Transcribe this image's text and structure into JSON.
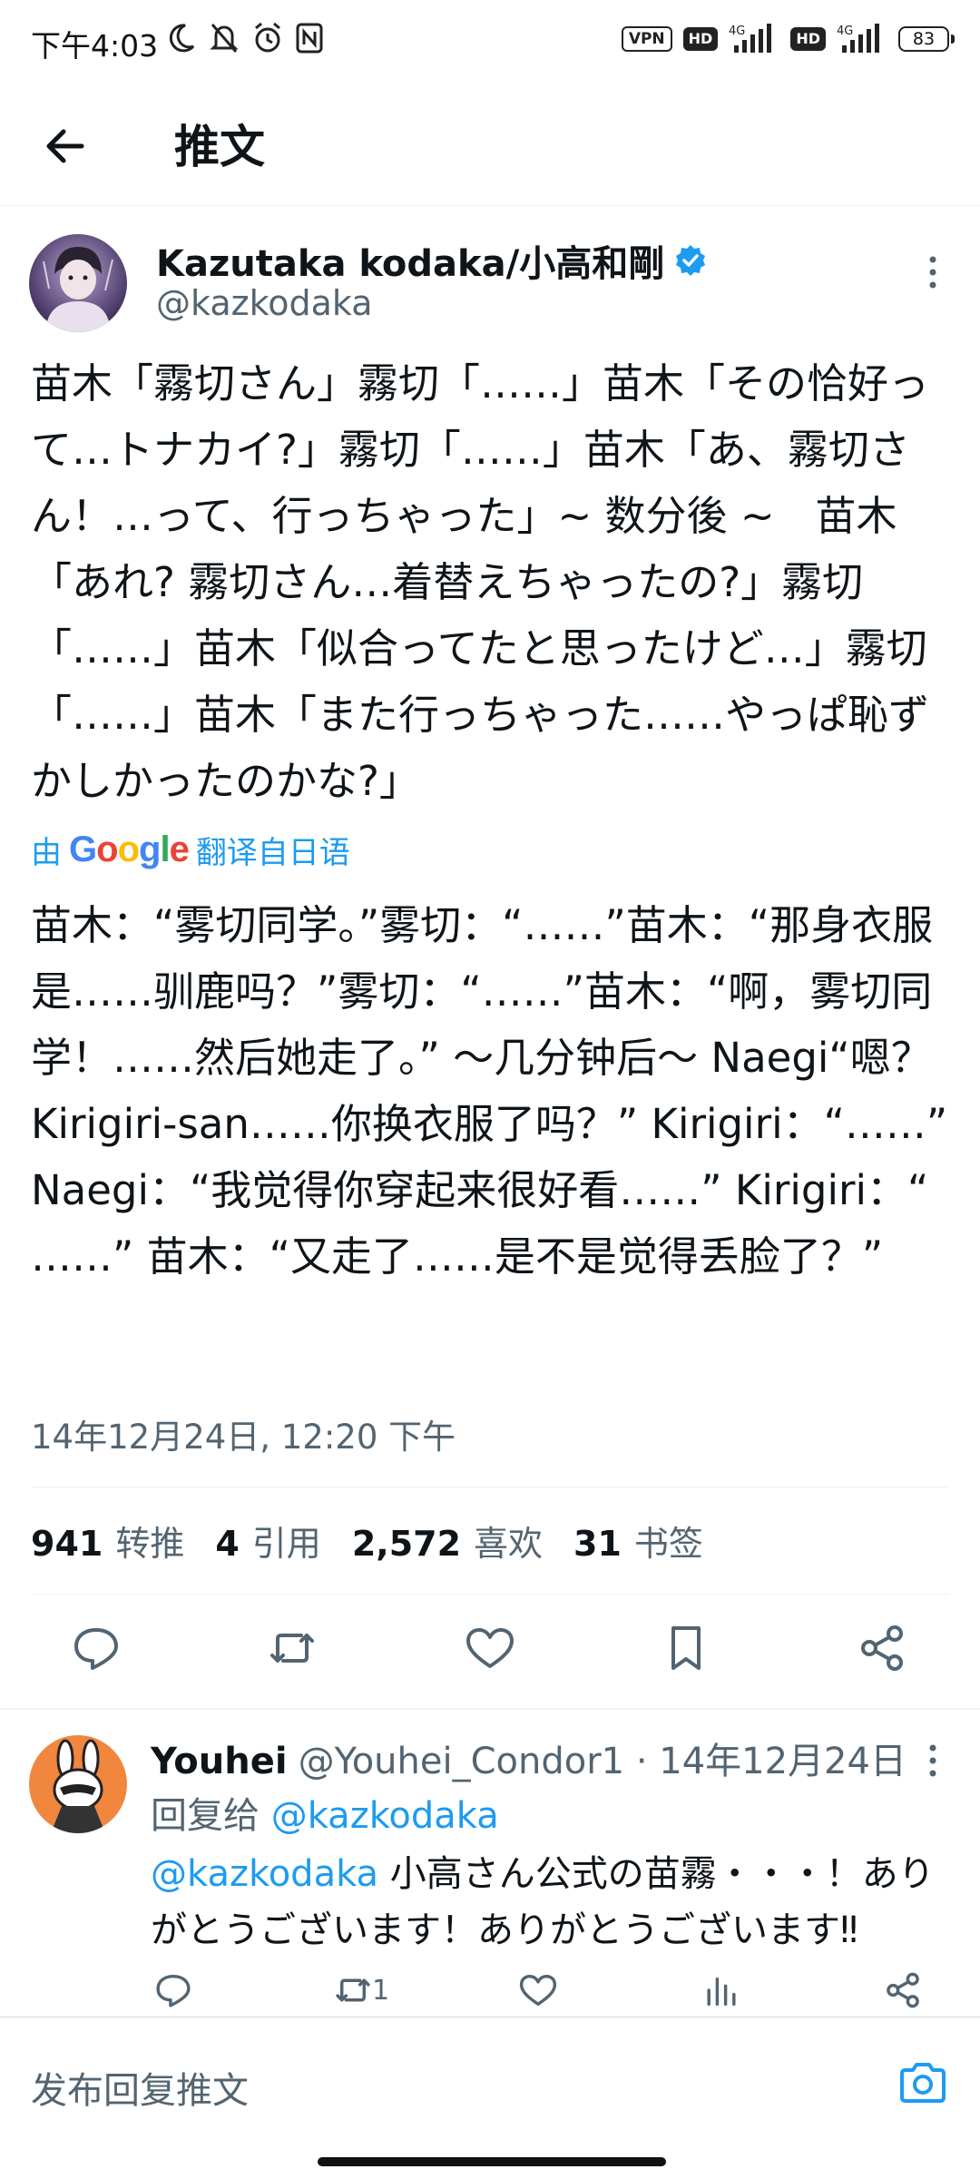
{
  "status_bar": {
    "time": "下午4:03",
    "vpn_label": "VPN",
    "hd_label": "HD",
    "net_label": "4G",
    "battery_level": "83"
  },
  "header": {
    "title": "推文"
  },
  "tweet": {
    "author_name": "Kazutaka kodaka/小高和剛",
    "handle": "@kazkodaka",
    "text": "苗木「霧切さん」霧切「……」苗木「その恰好って…トナカイ?」霧切「……」苗木「あ、霧切さん！…って、行っちゃった」~ 数分後 ~　苗木「あれ? 霧切さん…着替えちゃったの?」霧切「……」苗木「似合ってたと思ったけど…」霧切「……」苗木「また行っちゃった……やっぱ恥ずかしかったのかな?」",
    "translated_by": "由",
    "google_label": "Google",
    "translated_from": "翻译自日语",
    "translation": "苗木：“雾切同学。”雾切：“……”苗木：“那身衣服是……驯鹿吗？”雾切：“……”苗木：“啊，雾切同学！……然后她走了。” ～几分钟后～ Naegi“嗯？ Kirigiri-san……你换衣服了吗？” Kirigiri：“……” Naegi：“我觉得你穿起来很好看……” Kirigiri：“ ……” 苗木：“又走了……是不是觉得丢脸了？”",
    "timestamp": "14年12月24日, 12:20 下午",
    "stats": [
      {
        "num": "941",
        "label": "转推"
      },
      {
        "num": "4",
        "label": "引用"
      },
      {
        "num": "2,572",
        "label": "喜欢"
      },
      {
        "num": "31",
        "label": "书签"
      }
    ]
  },
  "reply": {
    "name": "Youhei",
    "handle_date": "@Youhei_Condor1 · 14年12月24日",
    "reply_prefix": "回复给",
    "reply_to": "@kazkodaka",
    "mention": "@kazkodaka",
    "text": " 小高さん公式の苗霧・・・！ありがとうございます！ありがとうございます‼",
    "retweet_count": "1"
  },
  "compose": {
    "placeholder": "发布回复推文"
  },
  "colors": {
    "accent": "#1d9bf0",
    "secondary_text": "#536471",
    "primary_text": "#0f1419"
  },
  "icons": [
    "back-arrow-icon",
    "verified-badge-icon",
    "more-icon",
    "reply-icon",
    "retweet-icon",
    "like-icon",
    "bookmark-icon",
    "share-icon",
    "views-icon",
    "camera-icon"
  ]
}
